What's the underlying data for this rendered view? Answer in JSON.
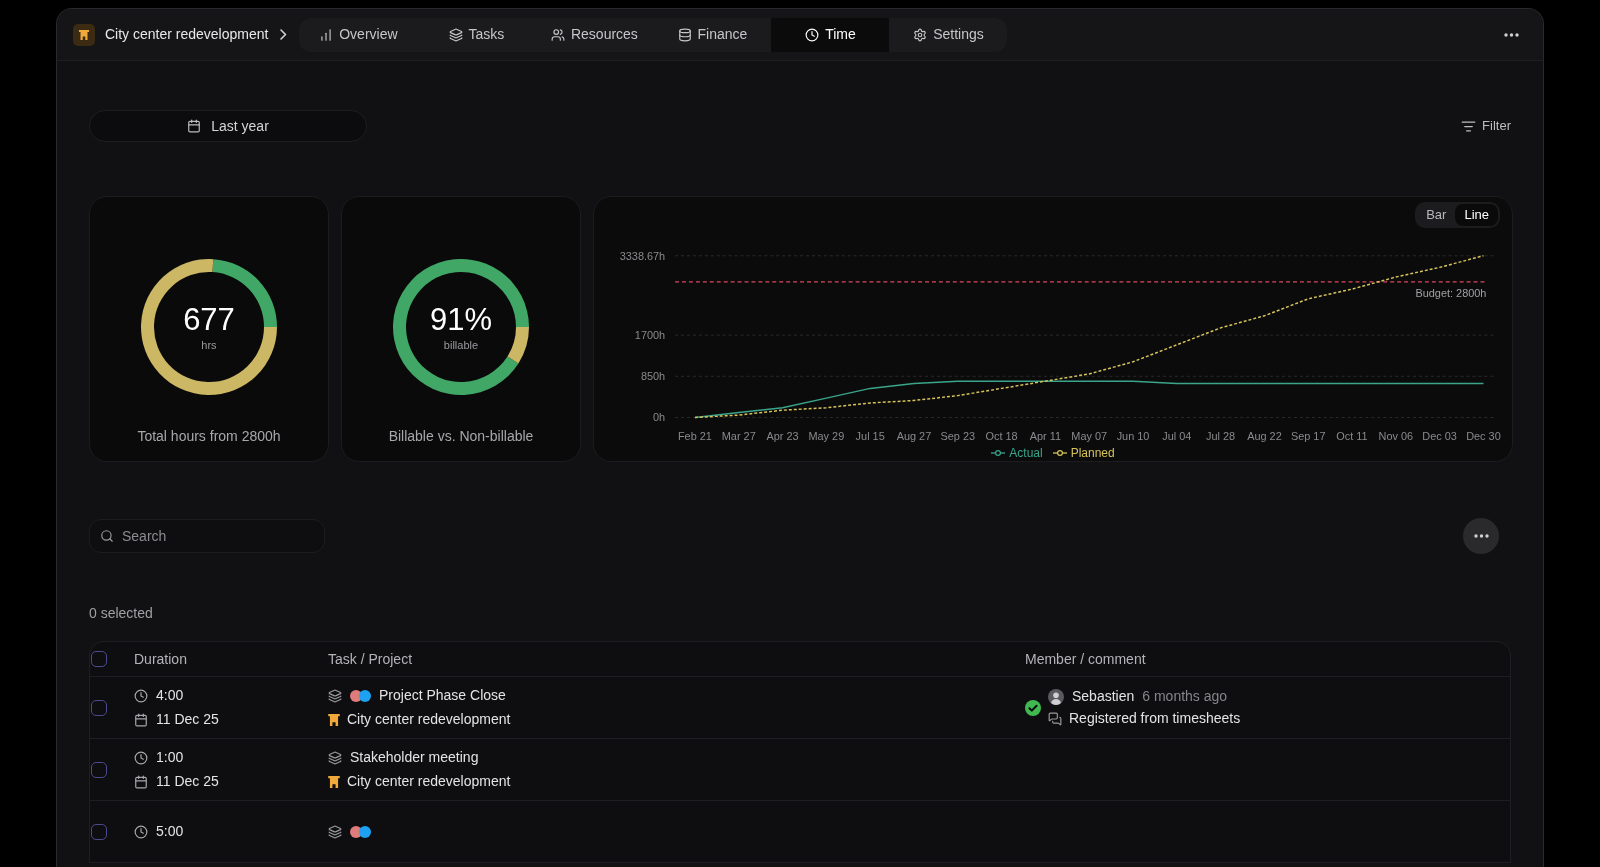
{
  "header": {
    "project": "City center redevelopment",
    "tabs": [
      {
        "label": "Overview",
        "selected": false
      },
      {
        "label": "Tasks",
        "selected": false
      },
      {
        "label": "Resources",
        "selected": false
      },
      {
        "label": "Finance",
        "selected": false
      },
      {
        "label": "Time",
        "selected": true
      },
      {
        "label": "Settings",
        "selected": false
      }
    ]
  },
  "toolbar": {
    "date_range": "Last year",
    "filter": "Filter"
  },
  "cards": [
    {
      "value": "677",
      "unit": "hrs",
      "caption": "Total hours from 2800h",
      "chart_data": {
        "type": "donut",
        "values": [
          24,
          76
        ]
      }
    },
    {
      "value": "91%",
      "unit": "billable",
      "caption": "Billable vs. Non-billable",
      "chart_data": {
        "type": "donut",
        "values": [
          91,
          9
        ]
      }
    }
  ],
  "chart": {
    "toggle": [
      {
        "label": "Bar",
        "selected": false
      },
      {
        "label": "Line",
        "selected": true
      }
    ],
    "chart_data": {
      "type": "line",
      "categories": [
        "Feb 21",
        "Mar 27",
        "Apr 23",
        "May 29",
        "Jul 15",
        "Aug 27",
        "Sep 23",
        "Oct 18",
        "Apr 11",
        "May 07",
        "Jun 10",
        "Jul 04",
        "Jul 28",
        "Aug 22",
        "Sep 17",
        "Oct 11",
        "Nov 06",
        "Dec 03",
        "Dec 30"
      ],
      "series": [
        {
          "name": "Actual",
          "color": "#3aa58a",
          "line_style": "solid",
          "values": [
            0,
            100,
            200,
            400,
            600,
            700,
            750,
            750,
            750,
            750,
            750,
            700,
            700,
            700,
            700,
            700,
            700,
            700,
            700
          ]
        },
        {
          "name": "Planned",
          "color": "#d6c35a",
          "line_style": "dashed",
          "values": [
            0,
            50,
            150,
            200,
            300,
            350,
            450,
            600,
            750,
            900,
            1150,
            1500,
            1850,
            2100,
            2450,
            2650,
            2900,
            3100,
            3338.67
          ]
        }
      ],
      "ylim": [
        0,
        3338.67
      ],
      "yticks": [
        {
          "value": 0,
          "label": "0h"
        },
        {
          "value": 850,
          "label": "850h"
        },
        {
          "value": 1700,
          "label": "1700h"
        },
        {
          "value": 3338.67,
          "label": "3338.67h"
        }
      ],
      "ref_lines": [
        {
          "axis": "y",
          "value": 2800,
          "label": "Budget: 2800h",
          "color": "#d9475e"
        }
      ],
      "legend": "bottom"
    }
  },
  "search": {
    "placeholder": "Search"
  },
  "table": {
    "selection": "0 selected",
    "all_checked": false,
    "columns": [
      "Duration",
      "Task / Project",
      "Member / comment"
    ],
    "rows": [
      {
        "checked": false,
        "duration": "4:00",
        "date": "11 Dec 25",
        "task": "Project Phase Close",
        "assignees": [
          {
            "color": "#e07b7b"
          },
          {
            "color": "#1da1f2"
          }
        ],
        "project": "City center redevelopment",
        "member": {
          "name": "Sebastien",
          "time": "6 months ago",
          "comment": "Registered from timesheets",
          "approved": true
        }
      },
      {
        "checked": false,
        "duration": "1:00",
        "date": "11 Dec 25",
        "task": "Stakeholder meeting",
        "project": "City center redevelopment"
      },
      {
        "checked": false,
        "duration": "5:00",
        "assignees": [
          {
            "color": "#e07b7b"
          },
          {
            "color": "#1da1f2"
          }
        ]
      }
    ]
  }
}
